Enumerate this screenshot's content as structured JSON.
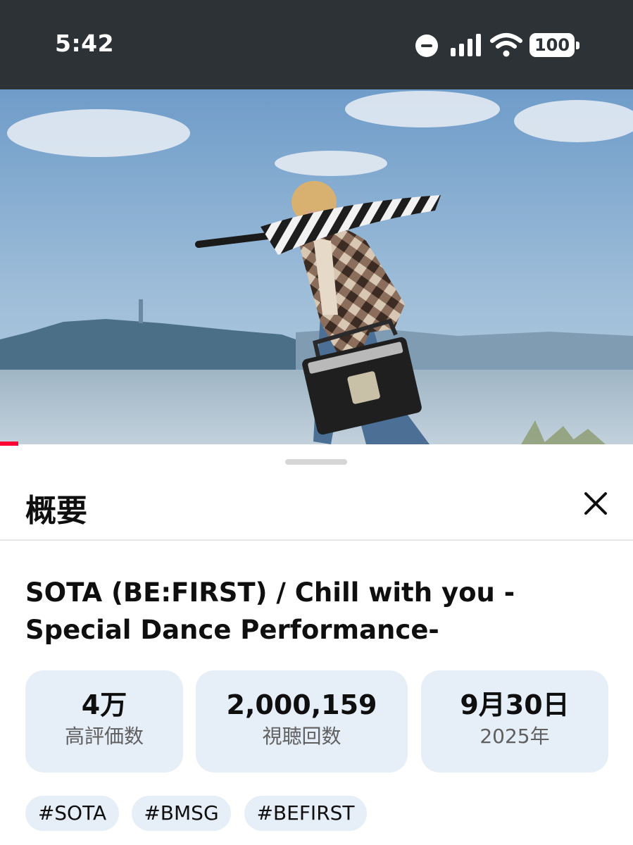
{
  "status_bar": {
    "time": "5:42",
    "battery": "100",
    "icons": [
      "do-not-disturb-icon",
      "signal-icon",
      "wifi-icon",
      "battery-icon"
    ]
  },
  "player": {
    "scene": "video-frame",
    "progress": 0.03,
    "progress_color": "#ff0033"
  },
  "sheet": {
    "title": "概要",
    "video_title": "SOTA (BE:FIRST) / Chill with you -Special Dance Performance-",
    "stats": {
      "likes_value": "4万",
      "likes_label": "高評価数",
      "views_value": "2,000,159",
      "views_label": "視聴回数",
      "date_value": "9月30日",
      "date_label": "2025年"
    },
    "tags": [
      "#SOTA",
      "#BMSG",
      "#BEFIRST"
    ]
  },
  "colors": {
    "status_bar_bg": "#2d3236",
    "chip_bg": "#e6eef8",
    "secondary_text": "#606060"
  }
}
